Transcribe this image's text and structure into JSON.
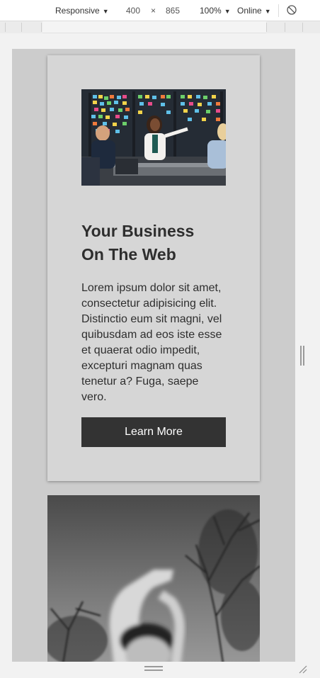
{
  "toolbar": {
    "device": "Responsive",
    "width": "400",
    "times": "×",
    "height": "865",
    "zoom": "100%",
    "network": "Online"
  },
  "card": {
    "title_line1": "Your Business",
    "title_line2": "On The Web",
    "body": "Lorem ipsum dolor sit amet, consectetur adipisicing elit. Distinctio eum sit magni, vel quibusdam ad eos iste esse et quaerat odio impedit, excepturi magnam quas tenetur a? Fuga, saepe vero.",
    "button_label": "Learn More"
  },
  "icons": {
    "rotate": "rotate-icon",
    "device_dropdown": "chevron-down-icon"
  }
}
